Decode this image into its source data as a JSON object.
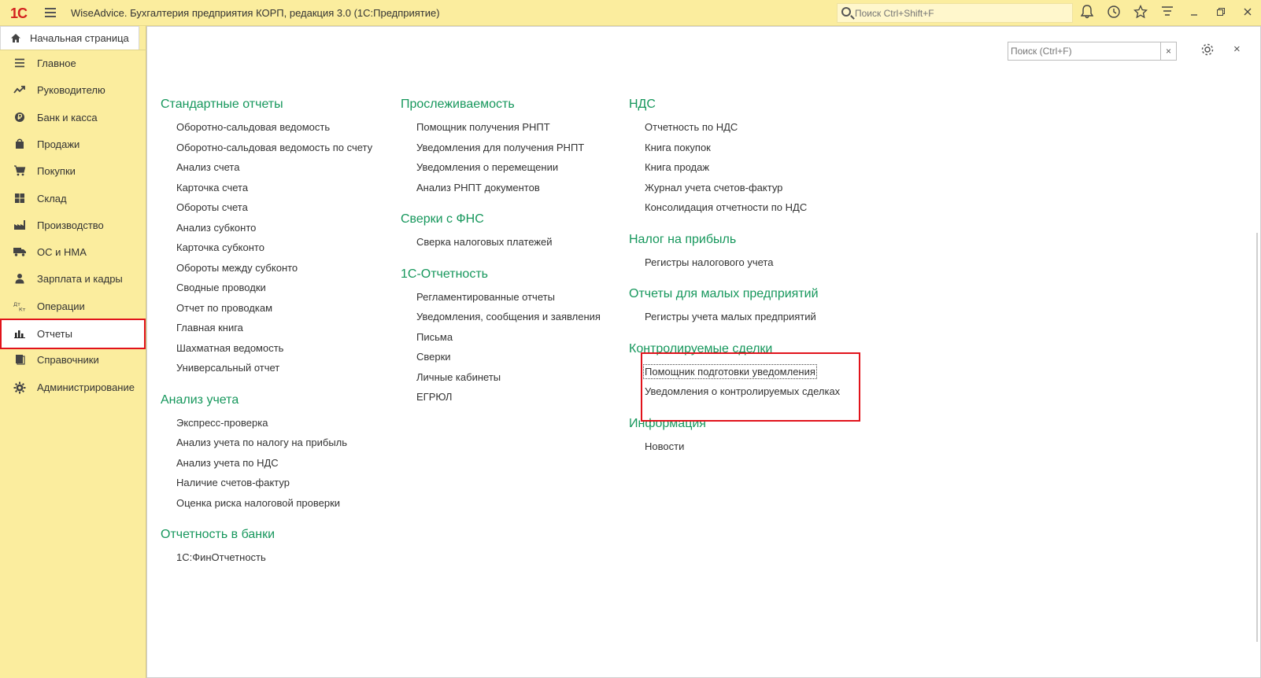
{
  "titlebar": {
    "logo": "1С",
    "title": "WiseAdvice. Бухгалтерия предприятия КОРП, редакция 3.0  (1С:Предприятие)",
    "search_placeholder": "Поиск Ctrl+Shift+F"
  },
  "sidebar": {
    "home_label": "Начальная страница",
    "items": [
      {
        "label": "Главное",
        "icon": "menu-lines-icon"
      },
      {
        "label": "Руководителю",
        "icon": "trend-chart-icon"
      },
      {
        "label": "Банк и касса",
        "icon": "coin-icon"
      },
      {
        "label": "Продажи",
        "icon": "shopping-bag-icon"
      },
      {
        "label": "Покупки",
        "icon": "cart-icon"
      },
      {
        "label": "Склад",
        "icon": "warehouse-grid-icon"
      },
      {
        "label": "Производство",
        "icon": "factory-icon"
      },
      {
        "label": "ОС и НМА",
        "icon": "truck-icon"
      },
      {
        "label": "Зарплата и кадры",
        "icon": "person-icon"
      },
      {
        "label": "Операции",
        "icon": "dt-kt-icon"
      },
      {
        "label": "Отчеты",
        "icon": "bar-chart-icon"
      },
      {
        "label": "Справочники",
        "icon": "book-icon"
      },
      {
        "label": "Администрирование",
        "icon": "gear-icon"
      }
    ],
    "active_index": 10
  },
  "main": {
    "search_placeholder": "Поиск (Ctrl+F)",
    "clear_label": "×",
    "close_label": "×",
    "columns": [
      {
        "sections": [
          {
            "title": "Стандартные отчеты",
            "links": [
              "Оборотно-сальдовая ведомость",
              "Оборотно-сальдовая ведомость по счету",
              "Анализ счета",
              "Карточка счета",
              "Обороты счета",
              "Анализ субконто",
              "Карточка субконто",
              "Обороты между субконто",
              "Сводные проводки",
              "Отчет по проводкам",
              "Главная книга",
              "Шахматная ведомость",
              "Универсальный отчет"
            ]
          },
          {
            "title": "Анализ учета",
            "links": [
              "Экспресс-проверка",
              "Анализ учета по налогу на прибыль",
              "Анализ учета по НДС",
              "Наличие счетов-фактур",
              "Оценка риска налоговой проверки"
            ]
          },
          {
            "title": "Отчетность в банки",
            "links": [
              "1С:ФинОтчетность"
            ]
          }
        ]
      },
      {
        "sections": [
          {
            "title": "Прослеживаемость",
            "links": [
              "Помощник получения РНПТ",
              "Уведомления для получения РНПТ",
              "Уведомления о перемещении",
              "Анализ РНПТ документов"
            ]
          },
          {
            "title": "Сверки с ФНС",
            "links": [
              "Сверка налоговых платежей"
            ]
          },
          {
            "title": "1С-Отчетность",
            "links": [
              "Регламентированные отчеты",
              "Уведомления, сообщения и заявления",
              "Письма",
              "Сверки",
              "Личные кабинеты",
              "ЕГРЮЛ"
            ]
          }
        ]
      },
      {
        "sections": [
          {
            "title": "НДС",
            "links": [
              "Отчетность по НДС",
              "Книга покупок",
              "Книга продаж",
              "Журнал учета счетов-фактур",
              "Консолидация отчетности по НДС"
            ]
          },
          {
            "title": "Налог на прибыль",
            "links": [
              "Регистры налогового учета"
            ]
          },
          {
            "title": "Отчеты для малых предприятий",
            "links": [
              "Регистры учета малых предприятий"
            ]
          },
          {
            "title": "Контролируемые сделки",
            "links": [
              "Помощник подготовки уведомления",
              "Уведомления о контролируемых сделках"
            ]
          },
          {
            "title": "Информация",
            "links": [
              "Новости"
            ]
          }
        ]
      }
    ]
  }
}
